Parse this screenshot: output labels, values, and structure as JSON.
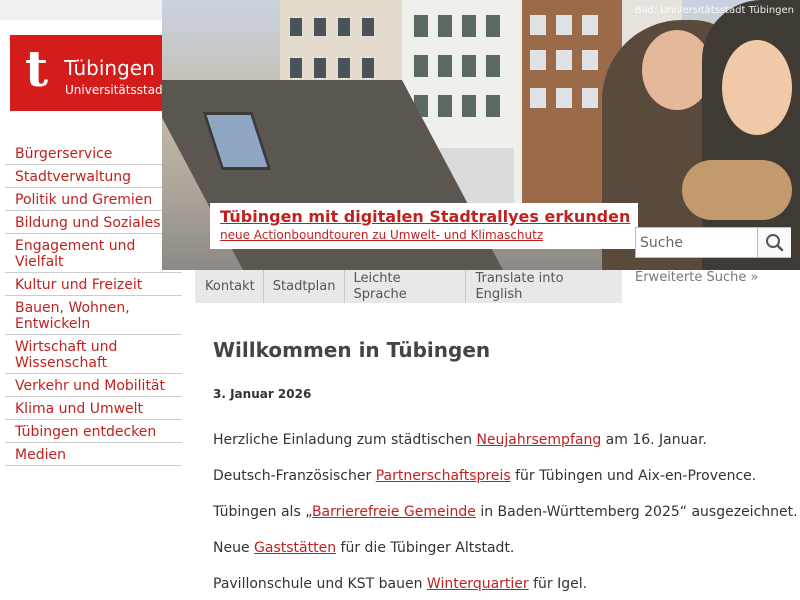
{
  "logo": {
    "mark": "t",
    "name": "Tübingen",
    "subtitle": "Universitätsstadt"
  },
  "nav": [
    "Bürgerservice",
    "Stadtverwaltung",
    "Politik und Gremien",
    "Bildung und Soziales",
    "Engagement und Vielfalt",
    "Kultur und Freizeit",
    "Bauen, Wohnen, Entwickeln",
    "Wirtschaft und Wissenschaft",
    "Verkehr und Mobilität",
    "Klima und Umwelt",
    "Tübingen entdecken",
    "Medien"
  ],
  "hero": {
    "credit": "Bild: Universitätsstadt Tübingen",
    "headline": "Tübingen mit digitalen Stadtrallyes erkunden",
    "subline": "neue Actionboundtouren zu Umwelt- und Klimaschutz"
  },
  "search": {
    "placeholder": "Suche",
    "advanced": "Erweiterte Suche »"
  },
  "servicebar": [
    "Kontakt",
    "Stadtplan",
    "Leichte Sprache",
    "Translate into English"
  ],
  "content": {
    "title": "Willkommen in Tübingen",
    "date": "3. Januar 2026",
    "news": [
      {
        "before": "Herzliche Einladung zum städtischen ",
        "link": "Neujahrsempfang",
        "after": " am 16. Januar."
      },
      {
        "before": "Deutsch-Französischer ",
        "link": "Partnerschaftspreis",
        "after": " für Tübingen und Aix-en-Provence."
      },
      {
        "before": "Tübingen als „",
        "link": "Barrierefreie Gemeinde",
        "after": " in Baden-Württemberg 2025“ ausgezeichnet."
      },
      {
        "before": "Neue ",
        "link": "Gaststätten",
        "after": " für die Tübinger Altstadt."
      },
      {
        "before": "Pavillonschule und KST bauen ",
        "link": "Winterquartier",
        "after": " für Igel."
      }
    ]
  },
  "colors": {
    "brand_red": "#d41c1b",
    "link_red": "#c0211f",
    "bar_gray": "#e8e8e8"
  },
  "icons": {
    "search": "magnifier-icon",
    "logo": "tuebingen-t-logo"
  }
}
